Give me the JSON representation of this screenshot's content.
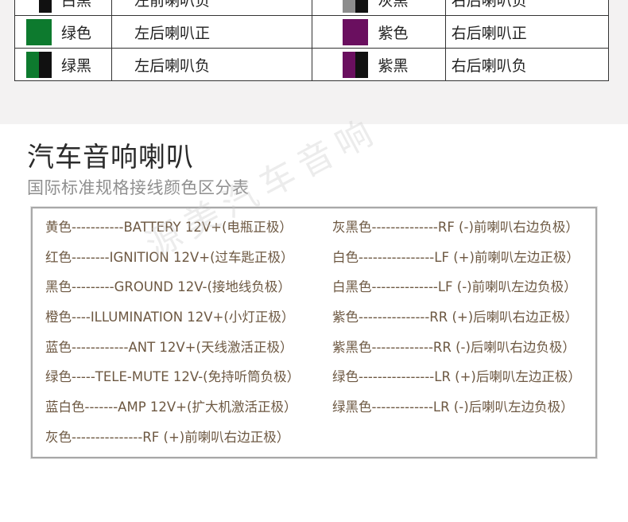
{
  "color_table": {
    "rows": [
      {
        "left": {
          "swatch": [
            "#ffffff",
            "#111111"
          ],
          "color_name": "白黑",
          "function": "左前喇叭负"
        },
        "right": {
          "swatch": [
            "#8d8d8d",
            "#111111"
          ],
          "color_name": "灰黑",
          "function": "右后喇叭负"
        }
      },
      {
        "left": {
          "swatch": [
            "#0d7a2e",
            "#0d7a2e"
          ],
          "color_name": "绿色",
          "function": "左后喇叭正"
        },
        "right": {
          "swatch": [
            "#6a0f5f",
            "#6a0f5f"
          ],
          "color_name": "紫色",
          "function": "右后喇叭正"
        }
      },
      {
        "left": {
          "swatch": [
            "#0d7a2e",
            "#111111"
          ],
          "color_name": "绿黑",
          "function": "左后喇叭负"
        },
        "right": {
          "swatch": [
            "#6a0f5f",
            "#111111"
          ],
          "color_name": "紫黑",
          "function": "右后喇叭负"
        }
      }
    ]
  },
  "heading": {
    "title": "汽车音响喇叭",
    "subtitle": "国际标准规格接线颜色区分表"
  },
  "wiring_list": {
    "left": [
      "黄色-----------BATTERY 12V+(电瓶正极）",
      "红色--------IGNITION 12V+(过车匙正极）",
      "黑色---------GROUND 12V-(接地线负极）",
      "橙色----ILLUMINATION 12V+(小灯正极）",
      "蓝色------------ANT 12V+(天线激活正极）",
      "绿色-----TELE-MUTE 12V-(免持听筒负极）",
      "蓝白色-------AMP 12V+(扩大机激活正极）",
      "灰色---------------RF (+)前喇叭右边正极）"
    ],
    "right": [
      "灰黑色--------------RF (-)前喇叭右边负极）",
      "白色----------------LF (+)前喇叭左边正极）",
      "白黑色--------------LF (-)前喇叭左边负极）",
      "紫色---------------RR (+)后喇叭右边正极）",
      "紫黑色-------------RR (-)后喇叭右边负极）",
      "绿色----------------LR (+)后喇叭左边正极）",
      "绿黑色-------------LR (-)后喇叭左边负极）"
    ]
  }
}
